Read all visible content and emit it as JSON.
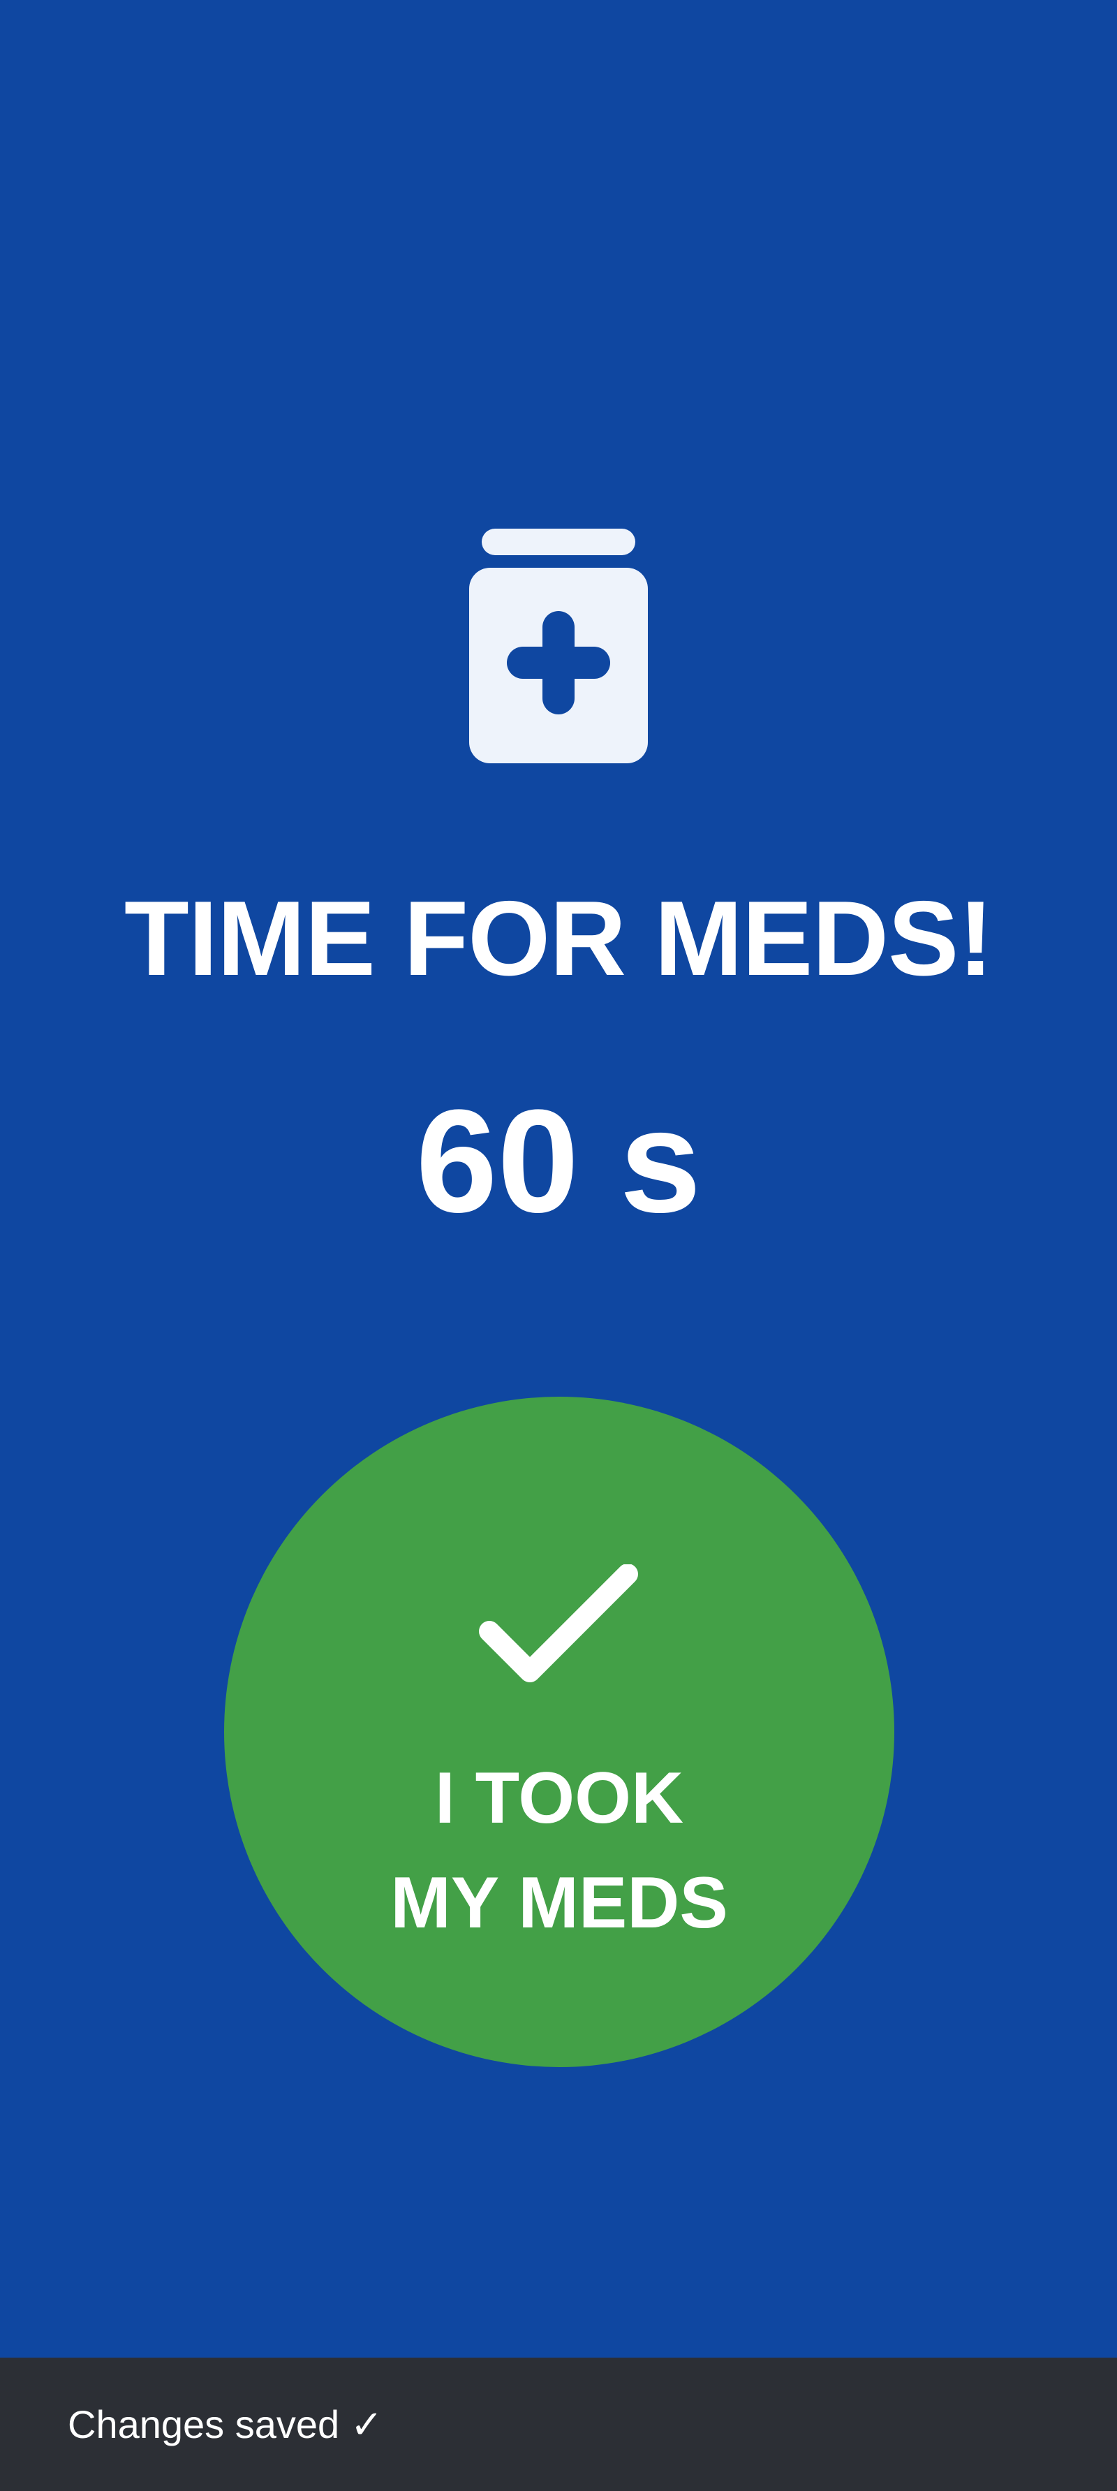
{
  "reminder": {
    "icon": "medicine-bottle-icon",
    "title": "TIME FOR MEDS!",
    "countdown": "60 s",
    "button": {
      "icon": "checkmark-icon",
      "line1": "I TOOK",
      "line2": "MY MEDS"
    }
  },
  "snackbar": {
    "message": "Changes saved ✓"
  },
  "colors": {
    "background": "#0F47A1",
    "button": "#43A047",
    "icon_fill": "#EEF3FB",
    "text": "#FFFFFF",
    "snackbar": "#2C2F35"
  }
}
